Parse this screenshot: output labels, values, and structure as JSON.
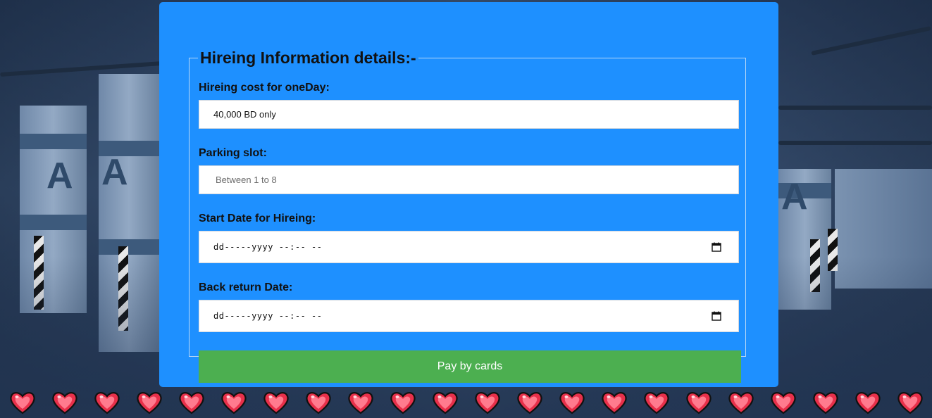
{
  "form": {
    "legend": "Hireing Information details:-",
    "fields": [
      {
        "label": "Hireing cost for oneDay:",
        "value": "40,000 BD only",
        "placeholder": ""
      },
      {
        "label": "Parking slot:",
        "value": "",
        "placeholder": "Between 1 to 8"
      },
      {
        "label": "Start Date for Hireing:",
        "value": "dd-----yyyy --:-- --",
        "icon": "calendar-icon"
      },
      {
        "label": "Back return Date:",
        "value": "dd-----yyyy --:-- --",
        "icon": "calendar-icon"
      }
    ],
    "submit_label": "Pay by cards"
  },
  "colors": {
    "card": "#1e90ff",
    "button": "#4caf50",
    "heart": "#e8304a"
  },
  "decor": {
    "heart_icon": "heart-icon",
    "heart_count": 22
  }
}
